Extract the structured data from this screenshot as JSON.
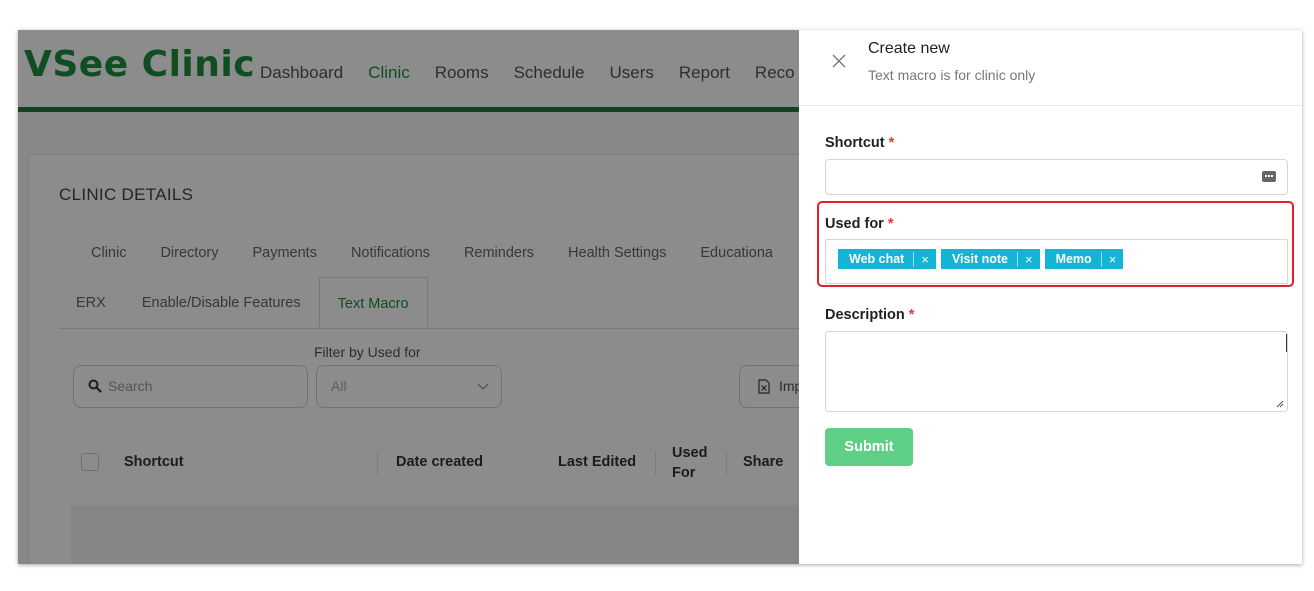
{
  "app": {
    "logo": "VSee Clinic",
    "nav": [
      "Dashboard",
      "Clinic",
      "Rooms",
      "Schedule",
      "Users",
      "Report",
      "Reco"
    ],
    "active_nav": "Clinic"
  },
  "page": {
    "section_title": "CLINIC DETAILS",
    "tabs_row1": [
      "Clinic",
      "Directory",
      "Payments",
      "Notifications",
      "Reminders",
      "Health Settings",
      "Educationa"
    ],
    "tabs_row2": [
      "ERX",
      "Enable/Disable Features",
      "Text Macro"
    ],
    "active_tab": "Text Macro",
    "search": {
      "placeholder": "Search"
    },
    "filter": {
      "label": "Filter by Used for",
      "value": "All"
    },
    "import_label": "Imp",
    "table": {
      "columns": [
        "Shortcut",
        "Date created",
        "Last Edited",
        "Used For",
        "Share"
      ]
    }
  },
  "drawer": {
    "title": "Create new",
    "subtitle": "Text macro is for clinic only",
    "shortcut_label": "Shortcut",
    "used_for_label": "Used for",
    "used_for_tags": [
      "Web chat",
      "Visit note",
      "Memo"
    ],
    "description_label": "Description",
    "required_mark": "*",
    "submit_label": "Submit",
    "tag_remove_glyph": "×"
  },
  "colors": {
    "brand_green": "#1e8f3f",
    "tag_cyan": "#13b4d4",
    "submit_green": "#5fcf85",
    "highlight_red": "#e0202a"
  }
}
